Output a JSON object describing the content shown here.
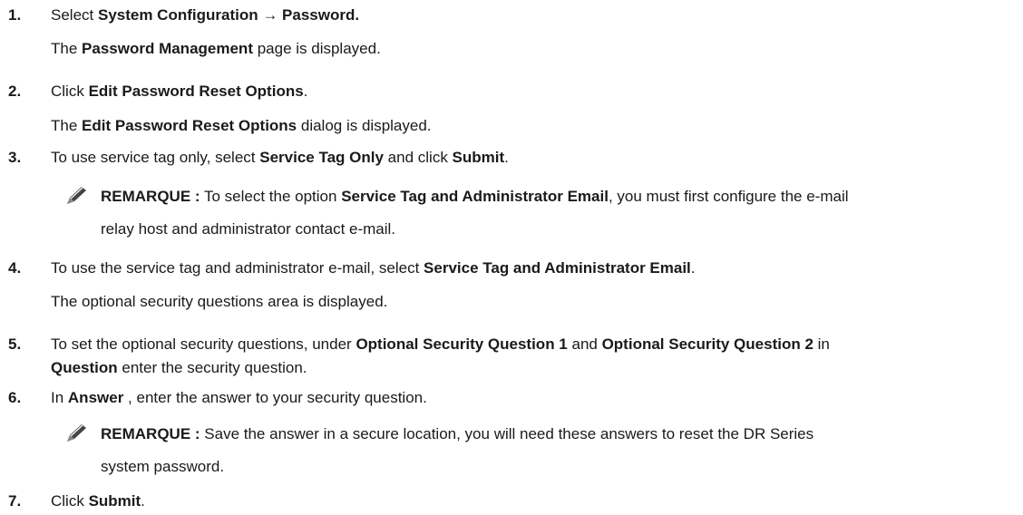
{
  "steps": [
    {
      "num": "1.",
      "prefix": "Select ",
      "b1": "System Configuration → Password.",
      "sub_prefix": "The ",
      "sub_b": "Password Management",
      "sub_suffix": " page is displayed."
    },
    {
      "num": "2.",
      "prefix": "Click ",
      "b1": "Edit Password Reset Options",
      "suffix": ".",
      "sub_prefix": "The ",
      "sub_b": "Edit Password Reset Options",
      "sub_suffix": " dialog is displayed."
    },
    {
      "num": "3.",
      "prefix": "To use service tag only, select ",
      "b1": "Service Tag Only",
      "mid": " and click ",
      "b2": "Submit",
      "suffix": "."
    },
    {
      "num": "4.",
      "prefix": "To use the service tag and administrator e-mail, select ",
      "b1": "Service Tag and Administrator Email",
      "suffix": ".",
      "sub_text": "The optional security questions area is displayed."
    },
    {
      "num": "5.",
      "prefix": "To set the optional security questions, under ",
      "b1": "Optional Security Question 1",
      "mid": " and ",
      "b2": "Optional Security Question 2",
      "suffix": " in",
      "line2_b": "Question",
      "line2_suffix": " enter the security question."
    },
    {
      "num": "6.",
      "prefix": "In ",
      "b1": "Answer",
      "suffix": " , enter the answer to your security question."
    },
    {
      "num": "7.",
      "prefix": "Click ",
      "b1": "Submit",
      "suffix": "."
    }
  ],
  "notes": [
    {
      "label": "REMARQUE :",
      "text1": " To select the option ",
      "b": "Service Tag and Administrator Email",
      "text2": ", you must first configure the e-mail",
      "line2": "relay host and administrator contact e-mail.",
      "icon": "pencil-icon"
    },
    {
      "label": "REMARQUE :",
      "text1": " Save the answer in a secure location, you will need these answers to reset the DR Series",
      "line2": "system password.",
      "icon": "pencil-icon"
    }
  ]
}
